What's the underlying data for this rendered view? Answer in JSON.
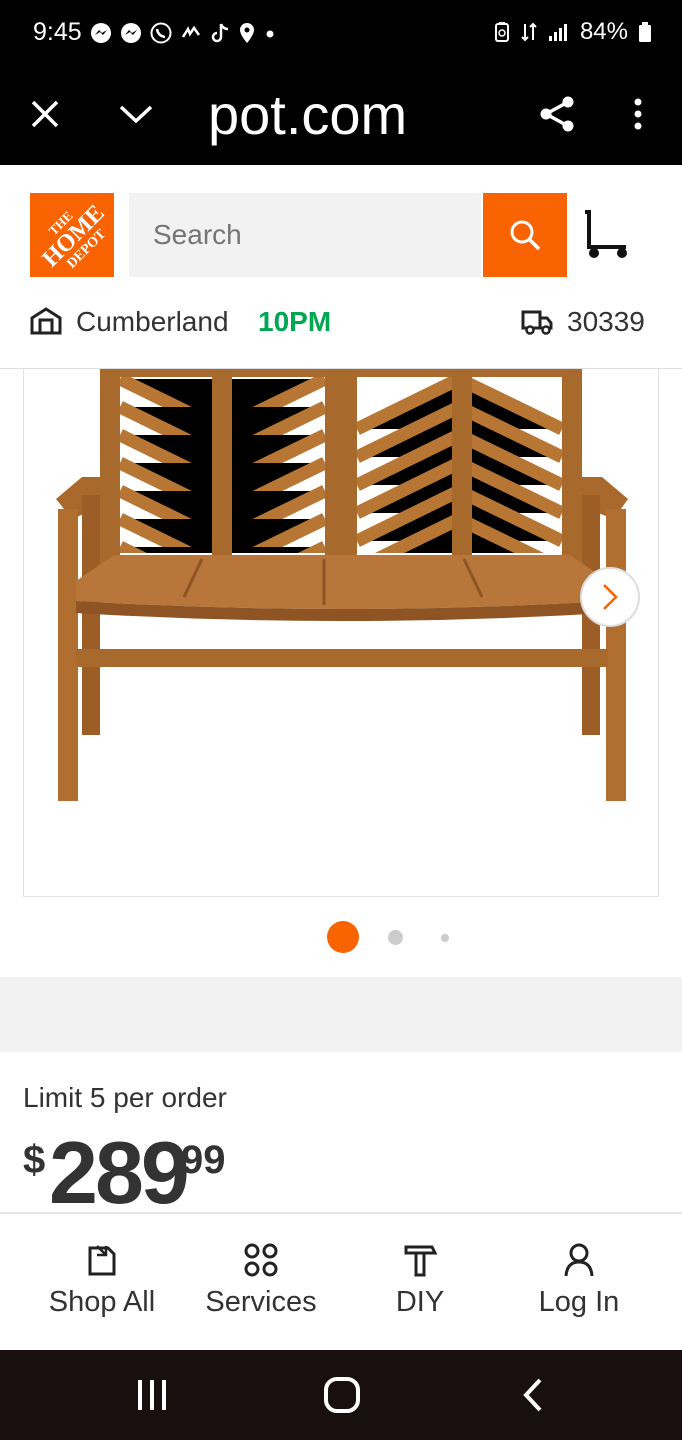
{
  "status_bar": {
    "time": "9:45",
    "battery": "84%"
  },
  "browser": {
    "url": "pot.com"
  },
  "header": {
    "logo_lines": [
      "THE",
      "HOME",
      "DEPOT"
    ],
    "search_placeholder": "Search",
    "store_name": "Cumberland",
    "store_hours": "10PM",
    "zip": "30339"
  },
  "gallery": {
    "image_count": 3,
    "active_index": 0
  },
  "product": {
    "limit_text": "Limit 5 per order",
    "price_symbol": "$",
    "price_dollars": "289",
    "price_cents": "99"
  },
  "bottom_nav": [
    {
      "label": "Shop All",
      "icon": "shop-all-icon"
    },
    {
      "label": "Services",
      "icon": "services-icon"
    },
    {
      "label": "DIY",
      "icon": "diy-hammer-icon"
    },
    {
      "label": "Log In",
      "icon": "user-icon"
    }
  ],
  "colors": {
    "brand_orange": "#f96302",
    "open_green": "#00a651",
    "text": "#333333"
  }
}
